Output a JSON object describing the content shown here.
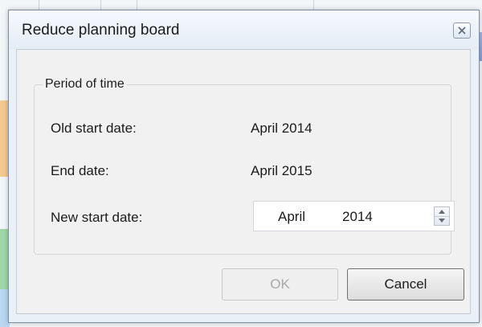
{
  "dialog": {
    "title": "Reduce planning board",
    "close_icon": "close-icon"
  },
  "group": {
    "caption": "Period of time",
    "old_start_label": "Old start date:",
    "old_start_value": "April 2014",
    "end_label": "End date:",
    "end_value": "April 2015",
    "new_start_label": "New start date:",
    "new_start_month": "April",
    "new_start_year": "2014"
  },
  "buttons": {
    "ok_label": "OK",
    "ok_enabled": false,
    "cancel_label": "Cancel"
  },
  "colors": {
    "dialog_bg": "#e9f0f8",
    "client_bg": "#f1f1f1",
    "disabled_text": "#a8a8a8"
  }
}
